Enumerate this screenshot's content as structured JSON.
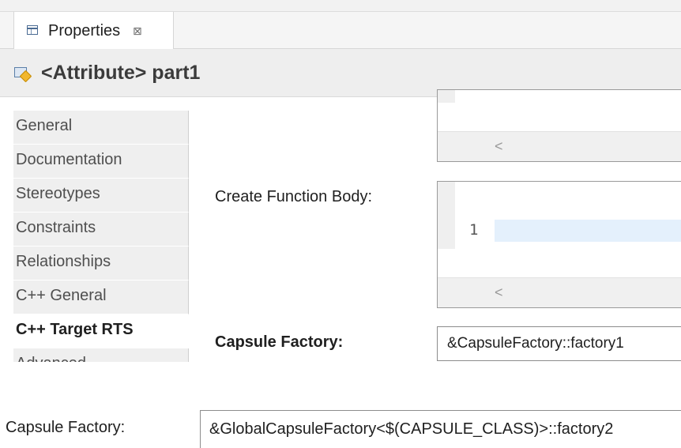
{
  "view": {
    "tab_label": "Properties",
    "tab_close_glyph": "⊠",
    "tab_icon": "properties-view-icon",
    "title": "<Attribute> part1",
    "title_icon": "attribute-icon"
  },
  "sidebar": {
    "items": [
      {
        "label": "General"
      },
      {
        "label": "Documentation"
      },
      {
        "label": "Stereotypes"
      },
      {
        "label": "Constraints"
      },
      {
        "label": "Relationships"
      },
      {
        "label": "C++ General"
      },
      {
        "label": "C++ Target RTS",
        "active": true
      },
      {
        "label": "Advanced"
      }
    ]
  },
  "form": {
    "create_function_body_label": "Create Function Body:",
    "line_number": "1",
    "scroll_left_glyph": "<",
    "capsule_factory_label": "Capsule Factory:",
    "capsule_factory_value": "&CapsuleFactory::factory1"
  },
  "bottom": {
    "capsule_factory_label": "Capsule Factory:",
    "capsule_factory_value": "&GlobalCapsuleFactory<$(CAPSULE_CLASS)>::factory2"
  }
}
